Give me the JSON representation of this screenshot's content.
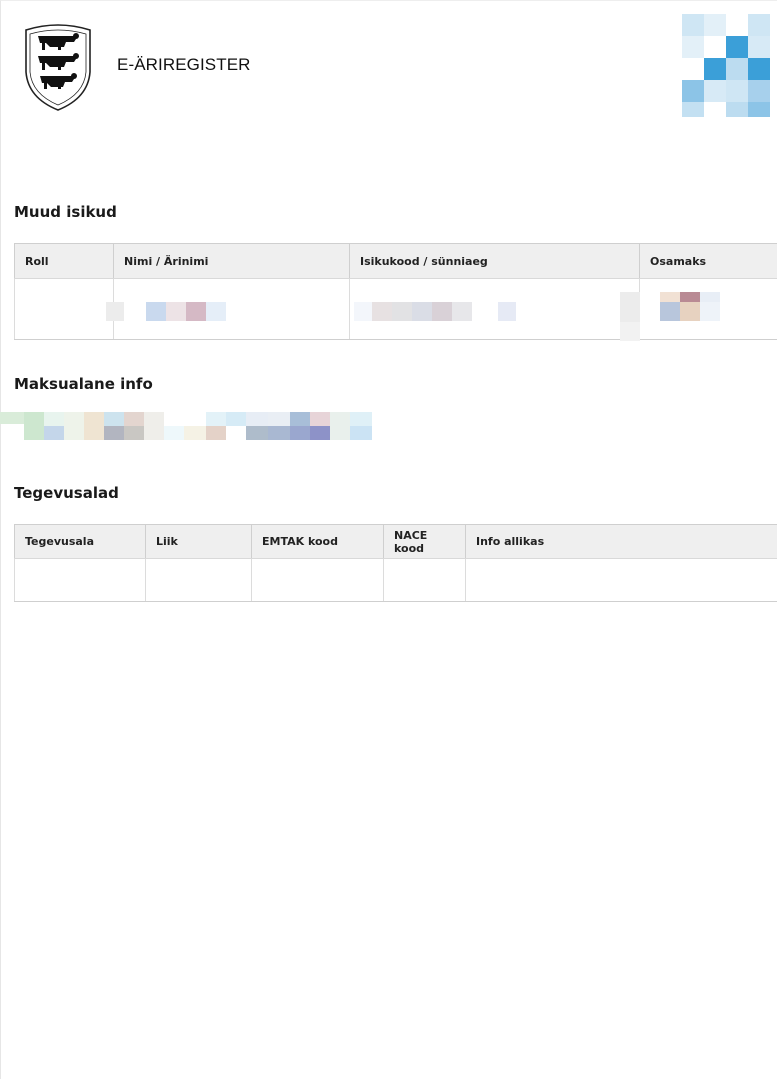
{
  "header": {
    "brand_text": "E-ÄRIREGISTER",
    "coat_icon": "coat-of-arms-icon",
    "logo_icon": "registry-mosaic-logo-icon"
  },
  "sections": {
    "other_persons": {
      "title": "Muud isikud",
      "columns": [
        "Roll",
        "Nimi / Ärinimi",
        "Isikukood / sünniaeg",
        "Osamaks"
      ]
    },
    "tax_info": {
      "title": "Maksualane info"
    },
    "activities": {
      "title": "Tegevusalad",
      "columns": [
        "Tegevusala",
        "Liik",
        "EMTAK kood",
        "NACE kood",
        "Info allikas"
      ]
    }
  },
  "colors": {
    "header_bg": "#efefef",
    "border": "#cfcfcf",
    "logo_blue_dark": "#3b9fd8",
    "logo_blue_light": "#c9e4f5"
  }
}
